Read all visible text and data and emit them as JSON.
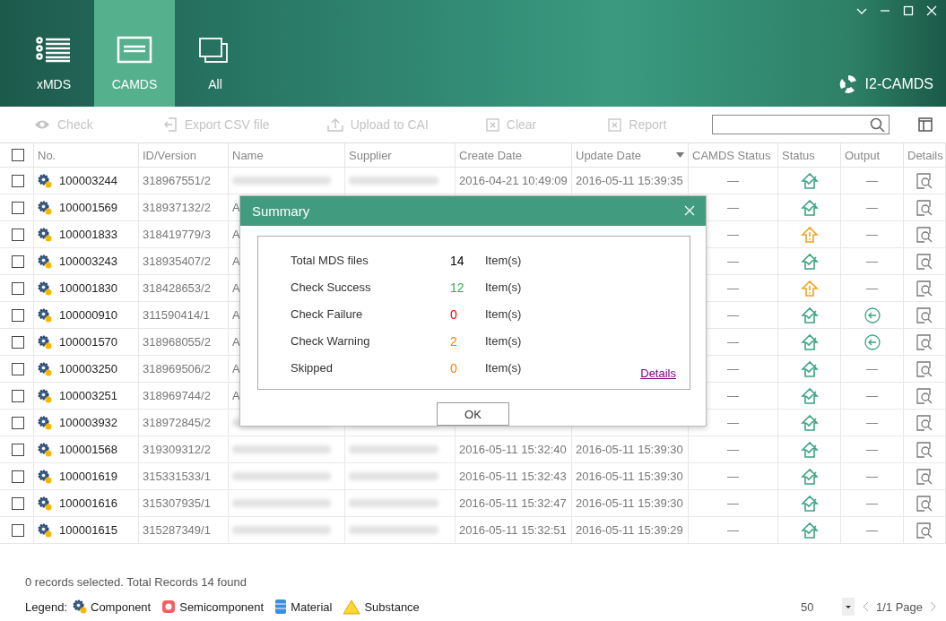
{
  "nav_tabs": [
    {
      "label": "xMDS",
      "selected": false
    },
    {
      "label": "CAMDS",
      "selected": true
    },
    {
      "label": "All",
      "selected": false
    }
  ],
  "brand": "I2-CAMDS",
  "toolbar": [
    {
      "label": "Check",
      "disabled": true
    },
    {
      "label": "Export CSV file",
      "disabled": true
    },
    {
      "label": "Upload to CAI",
      "disabled": true
    },
    {
      "label": "Clear",
      "disabled": true
    },
    {
      "label": "Report",
      "disabled": true
    }
  ],
  "table": {
    "select_all_checked": false,
    "columns": [
      "No.",
      "ID/Version",
      "Name",
      "Supplier",
      "Create Date",
      "Update Date",
      "CAMDS Status",
      "Status",
      "Output",
      "Details"
    ],
    "rows": [
      {
        "checked": false,
        "no": "100003244",
        "id": "318967551/2",
        "create": "2016-04-21 10:49:09",
        "update": "2016-05-11 15:39:35",
        "camds": "—",
        "status": {
          "kind": "ok"
        },
        "output": {
          "kind": "text",
          "text": "—"
        }
      },
      {
        "checked": false,
        "no": "100001569",
        "id": "318937132/2",
        "name": "A",
        "camds": "—",
        "status": {
          "kind": "ok"
        },
        "output": {
          "kind": "text",
          "text": "—"
        }
      },
      {
        "checked": false,
        "no": "100001833",
        "id": "318419779/3",
        "name": "A",
        "camds": "—",
        "status": {
          "kind": "warning"
        },
        "output": {
          "kind": "text",
          "text": "—"
        }
      },
      {
        "checked": false,
        "no": "100003243",
        "id": "318935407/2",
        "name": "A",
        "camds": "—",
        "status": {
          "kind": "ok"
        },
        "output": {
          "kind": "text",
          "text": "—"
        }
      },
      {
        "checked": false,
        "no": "100001830",
        "id": "318428653/2",
        "name": "A",
        "camds": "—",
        "status": {
          "kind": "warning"
        },
        "output": {
          "kind": "text",
          "text": "—"
        }
      },
      {
        "checked": false,
        "no": "100000910",
        "id": "311590414/1",
        "name": "A",
        "camds": "—",
        "status": {
          "kind": "ok"
        },
        "output": {
          "kind": "back"
        }
      },
      {
        "checked": false,
        "no": "100001570",
        "id": "318968055/2",
        "name": "A",
        "camds": "—",
        "status": {
          "kind": "ok"
        },
        "output": {
          "kind": "back"
        }
      },
      {
        "checked": false,
        "no": "100003250",
        "id": "318969506/2",
        "name": "A",
        "camds": "—",
        "status": {
          "kind": "ok"
        },
        "output": {
          "kind": "text",
          "text": "—"
        }
      },
      {
        "checked": false,
        "no": "100003251",
        "id": "318969744/2",
        "name": "A",
        "camds": "—",
        "status": {
          "kind": "ok"
        },
        "output": {
          "kind": "text",
          "text": "—"
        }
      },
      {
        "checked": false,
        "no": "100003932",
        "id": "318972845/2",
        "camds": "—",
        "status": {
          "kind": "ok"
        },
        "output": {
          "kind": "text",
          "text": "—"
        }
      },
      {
        "checked": false,
        "no": "100001568",
        "id": "319309312/2",
        "create": "2016-05-11 15:32:40",
        "update": "2016-05-11 15:39:30",
        "camds": "—",
        "status": {
          "kind": "ok"
        },
        "output": {
          "kind": "text",
          "text": "—"
        }
      },
      {
        "checked": false,
        "no": "100001619",
        "id": "315331533/1",
        "create": "2016-05-11 15:32:43",
        "update": "2016-05-11 15:39:30",
        "camds": "—",
        "status": {
          "kind": "ok"
        },
        "output": {
          "kind": "text",
          "text": "—"
        }
      },
      {
        "checked": false,
        "no": "100001616",
        "id": "315307935/1",
        "create": "2016-05-11 15:32:47",
        "update": "2016-05-11 15:39:30",
        "camds": "—",
        "status": {
          "kind": "ok"
        },
        "output": {
          "kind": "text",
          "text": "—"
        }
      },
      {
        "checked": false,
        "no": "100001615",
        "id": "315287349/1",
        "create": "2016-05-11 15:32:51",
        "update": "2016-05-11 15:39:29",
        "camds": "—",
        "status": {
          "kind": "ok"
        },
        "output": {
          "kind": "text",
          "text": "—"
        }
      }
    ]
  },
  "dialog": {
    "title": "Summary",
    "rows": [
      {
        "label": "Total MDS files",
        "value": "14",
        "unit": "Item(s)",
        "color": "#000000"
      },
      {
        "label": "Check Success",
        "value": "12",
        "unit": "Item(s)",
        "color": "#3aa55a"
      },
      {
        "label": "Check Failure",
        "value": "0",
        "unit": "Item(s)",
        "color": "#ff0000"
      },
      {
        "label": "Check Warning",
        "value": "2",
        "unit": "Item(s)",
        "color": "#ff8000"
      },
      {
        "label": "Skipped",
        "value": "0",
        "unit": "Item(s)",
        "color": "#ff8000"
      }
    ],
    "link": "Details",
    "button": "OK"
  },
  "status_bar": {
    "summary": "0 records selected. Total Records 14 found",
    "legend_label": "Legend:",
    "legend": [
      {
        "label": "Component",
        "kind": "component"
      },
      {
        "label": "Semicomponent",
        "kind": "semicomponent"
      },
      {
        "label": "Material",
        "kind": "material"
      },
      {
        "label": "Substance",
        "kind": "substance"
      }
    ],
    "page_size": "50",
    "page": "1/1 Page"
  }
}
